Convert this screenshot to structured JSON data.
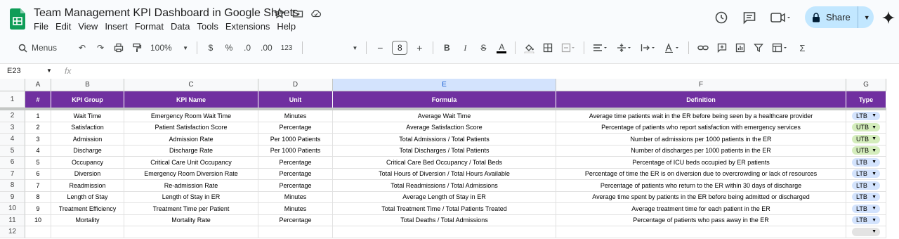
{
  "app": {
    "title": "Team Management KPI Dashboard in Google Sheets",
    "menu": [
      "File",
      "Edit",
      "View",
      "Insert",
      "Format",
      "Data",
      "Tools",
      "Extensions",
      "Help"
    ],
    "share_label": "Share"
  },
  "toolbar": {
    "search_label": "Menus",
    "zoom": "100%",
    "currency": "$",
    "percent": "%",
    "dec_decrease": ".0",
    "dec_increase": ".00",
    "number_format": "123",
    "font_size": "8",
    "minus": "−",
    "plus": "+",
    "bold": "B",
    "italic": "I",
    "strike": "S",
    "textcolor": "A",
    "sigma": "Σ"
  },
  "formula_bar": {
    "name_box": "E23",
    "fx": "fx"
  },
  "columns": [
    "A",
    "B",
    "C",
    "D",
    "E",
    "F",
    "G"
  ],
  "selected_column": "E",
  "header_row": [
    "#",
    "KPI Group",
    "KPI Name",
    "Unit",
    "Formula",
    "Definition",
    "Type"
  ],
  "rows": [
    [
      "1",
      "Wait Time",
      "Emergency Room Wait Time",
      "Minutes",
      "Average Wait Time",
      "Average time patients wait in the ER before being seen by a healthcare provider",
      "LTB"
    ],
    [
      "2",
      "Satisfaction",
      "Patient Satisfaction Score",
      "Percentage",
      "Average Satisfaction Score",
      "Percentage of patients who report satisfaction with emergency services",
      "UTB"
    ],
    [
      "3",
      "Admission",
      "Admission Rate",
      "Per 1000 Patients",
      "Total Admissions / Total Patients",
      "Number of admissions per 1000 patients in the ER",
      "UTB"
    ],
    [
      "4",
      "Discharge",
      "Discharge Rate",
      "Per 1000 Patients",
      "Total Discharges / Total Patients",
      "Number of discharges per 1000 patients in the ER",
      "UTB"
    ],
    [
      "5",
      "Occupancy",
      "Critical Care Unit Occupancy",
      "Percentage",
      "Critical Care Bed Occupancy / Total Beds",
      "Percentage of ICU beds occupied by ER patients",
      "LTB"
    ],
    [
      "6",
      "Diversion",
      "Emergency Room Diversion Rate",
      "Percentage",
      "Total Hours of Diversion / Total Hours Available",
      "Percentage of time the ER is on diversion due to overcrowding or lack of resources",
      "LTB"
    ],
    [
      "7",
      "Readmission",
      "Re-admission Rate",
      "Percentage",
      "Total Readmissions / Total Admissions",
      "Percentage of patients who return to the ER within 30 days of discharge",
      "LTB"
    ],
    [
      "8",
      "Length of Stay",
      "Length of Stay in ER",
      "Minutes",
      "Average Length of Stay in ER",
      "Average time spent by patients in the ER before being admitted or discharged",
      "LTB"
    ],
    [
      "9",
      "Treatment Efficiency",
      "Treatment Time per Patient",
      "Minutes",
      "Total Treatment Time / Total Patients Treated",
      "Average treatment time for each patient in the ER",
      "LTB"
    ],
    [
      "10",
      "Mortality",
      "Mortality Rate",
      "Percentage",
      "Total Deaths / Total Admissions",
      "Percentage of patients who pass away in the ER",
      "LTB"
    ]
  ],
  "row_numbers": [
    "1",
    "2",
    "3",
    "4",
    "5",
    "6",
    "7",
    "8",
    "9",
    "10",
    "11",
    "12"
  ],
  "colors": {
    "header_bg": "#7030a0",
    "ltb_chip": "#d3e3fd",
    "utb_chip": "#d4edbc",
    "selected_col": "#d3e3fd"
  }
}
